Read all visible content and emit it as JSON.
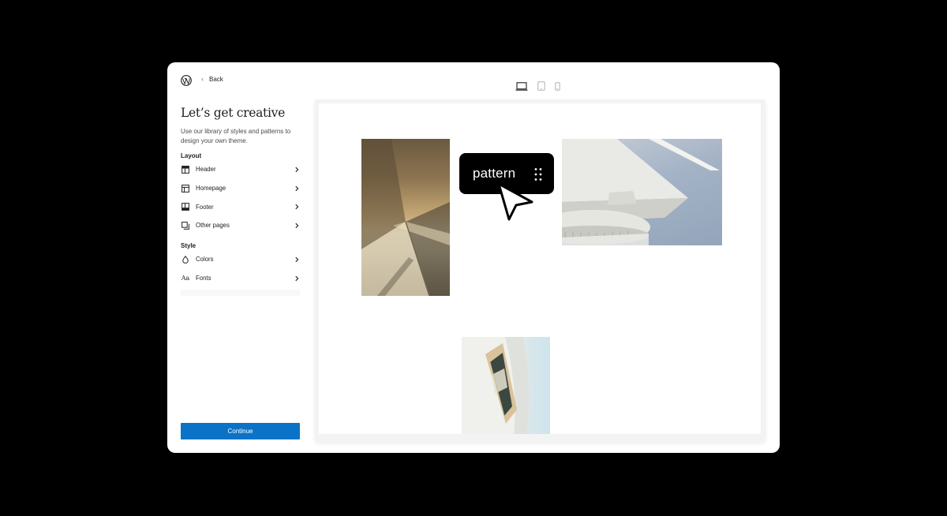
{
  "nav": {
    "back_label": "Back"
  },
  "sidebar": {
    "title": "Let’s get creative",
    "description": "Use our library of styles and patterns to design your own theme.",
    "layout_label": "Layout",
    "layout_items": [
      {
        "label": "Header",
        "icon": "header-icon"
      },
      {
        "label": "Homepage",
        "icon": "homepage-icon"
      },
      {
        "label": "Footer",
        "icon": "footer-icon"
      },
      {
        "label": "Other pages",
        "icon": "pages-icon"
      }
    ],
    "style_label": "Style",
    "style_items": [
      {
        "label": "Colors",
        "icon": "droplet-icon"
      },
      {
        "label": "Fonts",
        "icon": "fonts-icon"
      }
    ],
    "fonts_icon_glyph": "Aa",
    "continue_label": "Continue"
  },
  "devices": [
    {
      "name": "desktop",
      "icon": "desktop-icon",
      "active": true
    },
    {
      "name": "tablet",
      "icon": "tablet-icon",
      "active": false
    },
    {
      "name": "mobile",
      "icon": "mobile-icon",
      "active": false
    }
  ],
  "canvas": {
    "tooltip_text": "pattern"
  },
  "colors": {
    "accent": "#0b73c7",
    "background": "#000000",
    "panel": "#ffffff"
  }
}
